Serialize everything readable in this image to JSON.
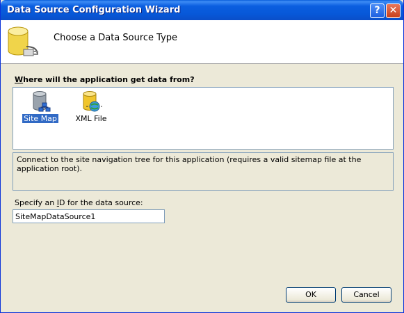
{
  "window": {
    "title": "Data Source Configuration Wizard",
    "help_glyph": "?",
    "close_glyph": "✕"
  },
  "header": {
    "title": "Choose a Data Source Type",
    "icon": "database-plug-icon"
  },
  "source_question": {
    "accel": "W",
    "rest": "here will the application get data from?"
  },
  "data_sources": [
    {
      "label": "Site Map",
      "icon": "sitemap-database-icon",
      "selected": true
    },
    {
      "label": "XML File",
      "icon": "xml-database-icon",
      "selected": false
    }
  ],
  "description": "Connect to the site navigation tree for this application (requires a valid sitemap file at the application root).",
  "id_field": {
    "label_pre": "Specify an ",
    "accel": "I",
    "label_post": "D for the data source:",
    "value": "SiteMapDataSource1"
  },
  "buttons": {
    "ok": "OK",
    "cancel": "Cancel"
  },
  "colors": {
    "title_bar": "#0b5ee0",
    "selection": "#316ac5",
    "dialog_bg": "#ece9d8"
  }
}
